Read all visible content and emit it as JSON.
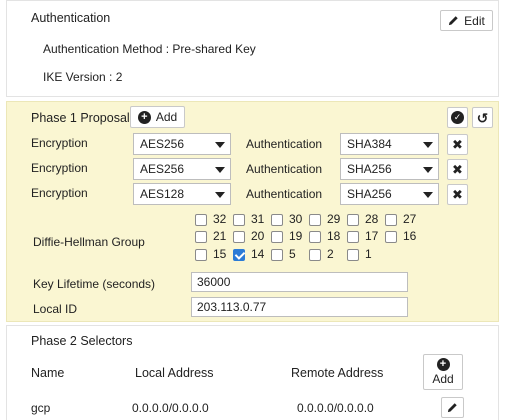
{
  "authentication": {
    "title": "Authentication",
    "edit_label": "Edit",
    "method_line": "Authentication Method : Pre-shared Key",
    "ike_line": "IKE Version : 2"
  },
  "phase1": {
    "title": "Phase 1 Proposal",
    "add_label": "Add",
    "rows": [
      {
        "enc_label": "Encryption",
        "enc_value": "AES256",
        "auth_label": "Authentication",
        "auth_value": "SHA384"
      },
      {
        "enc_label": "Encryption",
        "enc_value": "AES256",
        "auth_label": "Authentication",
        "auth_value": "SHA256"
      },
      {
        "enc_label": "Encryption",
        "enc_value": "AES128",
        "auth_label": "Authentication",
        "auth_value": "SHA256"
      }
    ],
    "dh_label": "Diffie-Hellman Group",
    "dh_groups": [
      {
        "label": "32",
        "checked": false
      },
      {
        "label": "31",
        "checked": false
      },
      {
        "label": "30",
        "checked": false
      },
      {
        "label": "29",
        "checked": false
      },
      {
        "label": "28",
        "checked": false
      },
      {
        "label": "27",
        "checked": false
      },
      {
        "label": "21",
        "checked": false
      },
      {
        "label": "20",
        "checked": false
      },
      {
        "label": "19",
        "checked": false
      },
      {
        "label": "18",
        "checked": false
      },
      {
        "label": "17",
        "checked": false
      },
      {
        "label": "16",
        "checked": false
      },
      {
        "label": "15",
        "checked": false
      },
      {
        "label": "14",
        "checked": true
      },
      {
        "label": "5",
        "checked": false
      },
      {
        "label": "2",
        "checked": false
      },
      {
        "label": "1",
        "checked": false
      }
    ],
    "key_lifetime_label": "Key Lifetime (seconds)",
    "key_lifetime_value": "36000",
    "local_id_label": "Local ID",
    "local_id_value": "203.113.0.77"
  },
  "phase2": {
    "title": "Phase 2 Selectors",
    "columns": [
      "Name",
      "Local Address",
      "Remote Address"
    ],
    "add_label": "Add",
    "rows": [
      {
        "name": "gcp",
        "local": "0.0.0.0/0.0.0.0",
        "remote": "0.0.0.0/0.0.0.0"
      }
    ]
  },
  "colors": {
    "highlight_bg": "#faf6d2",
    "checkbox_checked": "#2b7bd6"
  }
}
